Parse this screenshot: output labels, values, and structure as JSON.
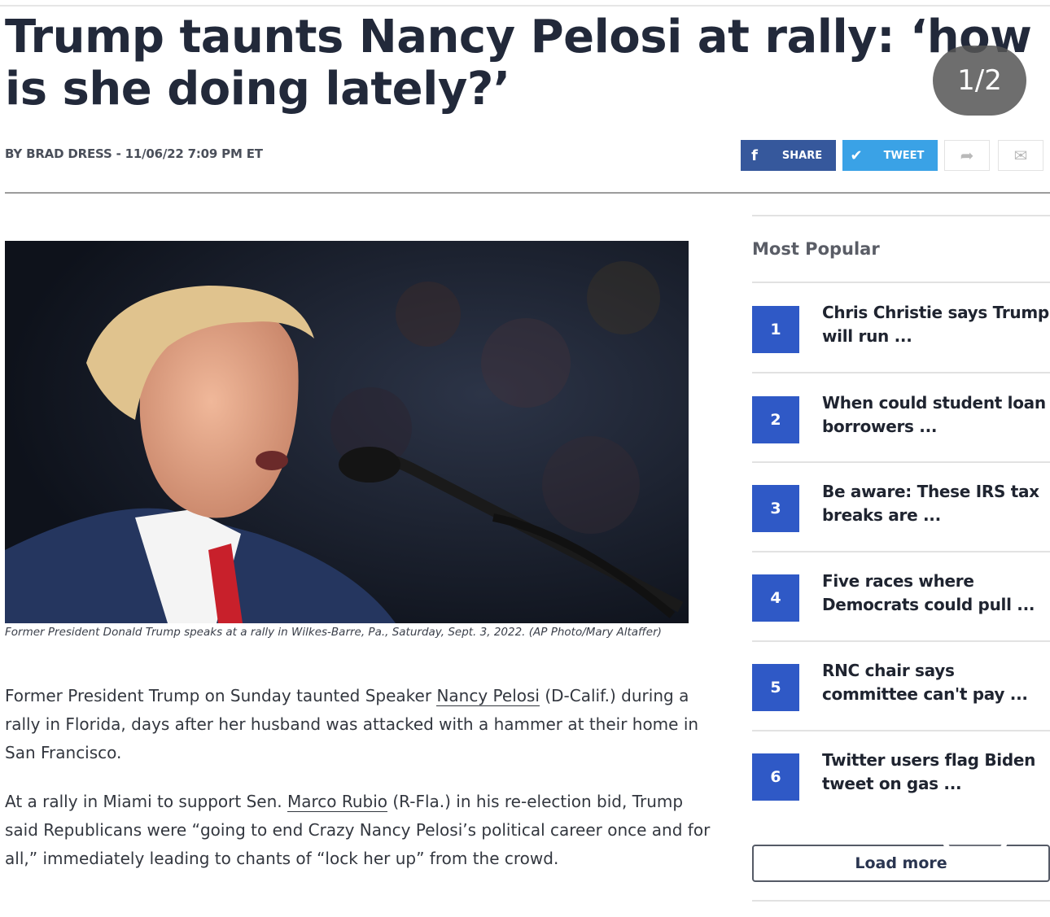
{
  "article": {
    "headline": "Trump taunts Nancy Pelosi at rally: ‘how is she doing lately?’",
    "byline": "BY BRAD DRESS - 11/06/22 7:09 PM ET",
    "caption": "Former President Donald Trump speaks at a rally in Wilkes-Barre, Pa., Saturday, Sept. 3, 2022. (AP Photo/Mary Altaffer)",
    "p1_a": "Former President Trump on Sunday taunted Speaker ",
    "p1_link": "Nancy Pelosi",
    "p1_b": " (D-Calif.) during a rally in Florida, days after her husband was attacked with a hammer at their home in San Francisco.",
    "p2_a": "At a rally in Miami to support Sen. ",
    "p2_link": "Marco Rubio",
    "p2_b": " (R-Fla.) in his re-election bid, Trump said Republicans were “going to end Crazy Nancy Pelosi’s political career once and for all,” immediately leading to chants of “lock her up” from the crowd."
  },
  "overlay": {
    "slide_counter": "1/2",
    "heart_icon": "heart-outline-icon"
  },
  "share": {
    "facebook_label": "SHARE",
    "facebook_icon": "f",
    "twitter_label": "TWEET",
    "twitter_icon": "✔",
    "forward_icon": "➦",
    "mail_icon": "✉",
    "colors": {
      "facebook": "#36589c",
      "twitter": "#3aa2e6"
    }
  },
  "sidebar": {
    "title": "Most Popular",
    "accent": "#2f59c6",
    "items": [
      {
        "num": "1",
        "text": "Chris Christie says Trump will run ..."
      },
      {
        "num": "2",
        "text": "When could student loan borrowers ..."
      },
      {
        "num": "3",
        "text": "Be aware: These IRS tax breaks are ..."
      },
      {
        "num": "4",
        "text": "Five races where Democrats could pull ..."
      },
      {
        "num": "5",
        "text": "RNC chair says committee can't pay ..."
      },
      {
        "num": "6",
        "text": "Twitter users flag Biden tweet on gas ..."
      }
    ],
    "load_more": "Load more"
  }
}
